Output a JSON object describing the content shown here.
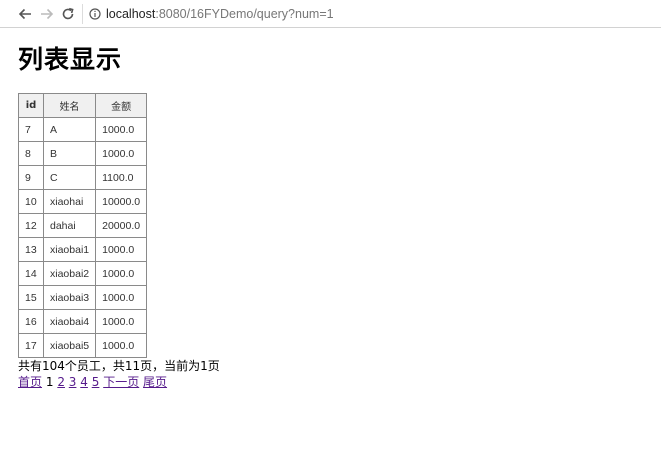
{
  "browser": {
    "url_host": "localhost",
    "url_rest": ":8080/16FYDemo/query?num=1"
  },
  "page": {
    "title": "列表显示"
  },
  "table": {
    "headers": [
      "id",
      "姓名",
      "金额"
    ],
    "rows": [
      [
        "7",
        "A",
        "1000.0"
      ],
      [
        "8",
        "B",
        "1000.0"
      ],
      [
        "9",
        "C",
        "1100.0"
      ],
      [
        "10",
        "xiaohai",
        "10000.0"
      ],
      [
        "12",
        "dahai",
        "20000.0"
      ],
      [
        "13",
        "xiaobai1",
        "1000.0"
      ],
      [
        "14",
        "xiaobai2",
        "1000.0"
      ],
      [
        "15",
        "xiaobai3",
        "1000.0"
      ],
      [
        "16",
        "xiaobai4",
        "1000.0"
      ],
      [
        "17",
        "xiaobai5",
        "1000.0"
      ]
    ]
  },
  "summary": "共有104个员工，共11页，当前为1页",
  "pager": {
    "first": "首页",
    "current": "1",
    "pages": [
      "2",
      "3",
      "4",
      "5"
    ],
    "next": "下一页",
    "last": "尾页"
  }
}
